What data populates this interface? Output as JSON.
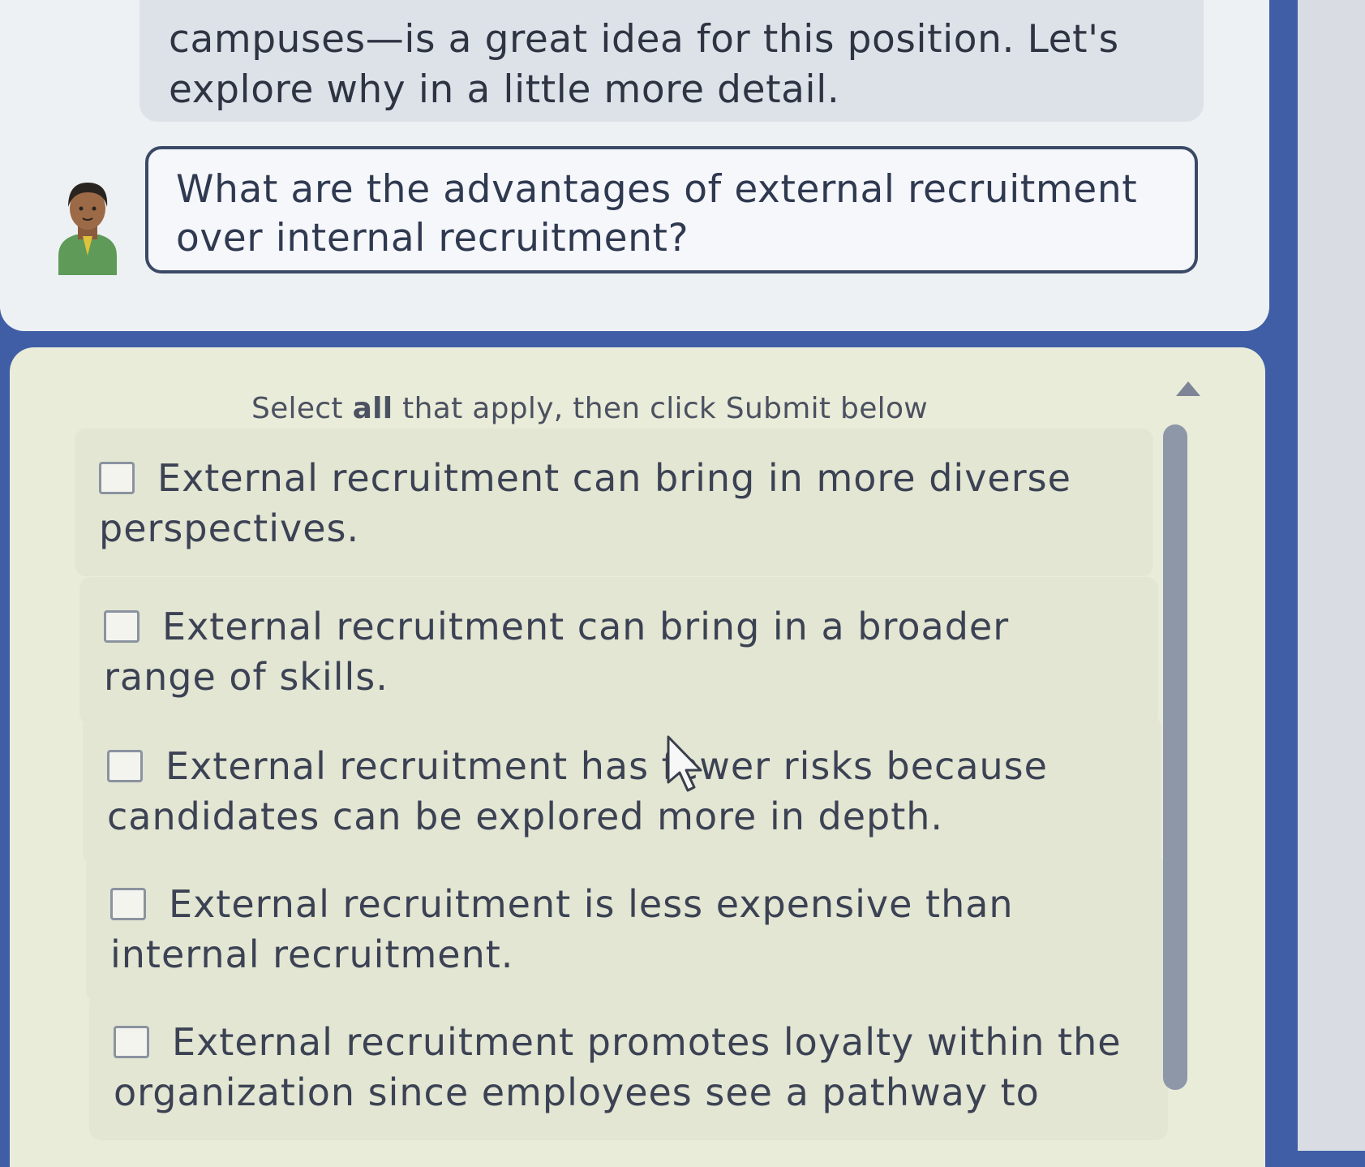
{
  "conversation": {
    "previous_message": "campuses—is a great idea for this position. Let's explore why in a little more detail.",
    "question": "What are the advantages of external recruitment over internal recruitment?"
  },
  "answer_panel": {
    "instruction_prefix": "Select ",
    "instruction_bold": "all",
    "instruction_suffix": " that apply, then click Submit below",
    "options": [
      {
        "label": "External recruitment can bring in more diverse perspectives.",
        "checked": false
      },
      {
        "label": "External recruitment can bring in a broader range of skills.",
        "checked": false
      },
      {
        "label": "External recruitment has fewer risks because candidates can be explored more in depth.",
        "checked": false
      },
      {
        "label": "External recruitment is less expensive than internal recruitment.",
        "checked": false
      },
      {
        "label": "External recruitment promotes loyalty within the organization since employees see a pathway to",
        "checked": false
      }
    ]
  },
  "icons": [
    "person-avatar-icon",
    "scroll-up-arrow-icon",
    "mouse-cursor-icon",
    "checkbox-icon"
  ],
  "colors": {
    "page_bg": "#3f5ea6",
    "card_bg": "#eef1f4",
    "panel_bg": "#e9ecd8",
    "question_border": "#3a4a66"
  }
}
